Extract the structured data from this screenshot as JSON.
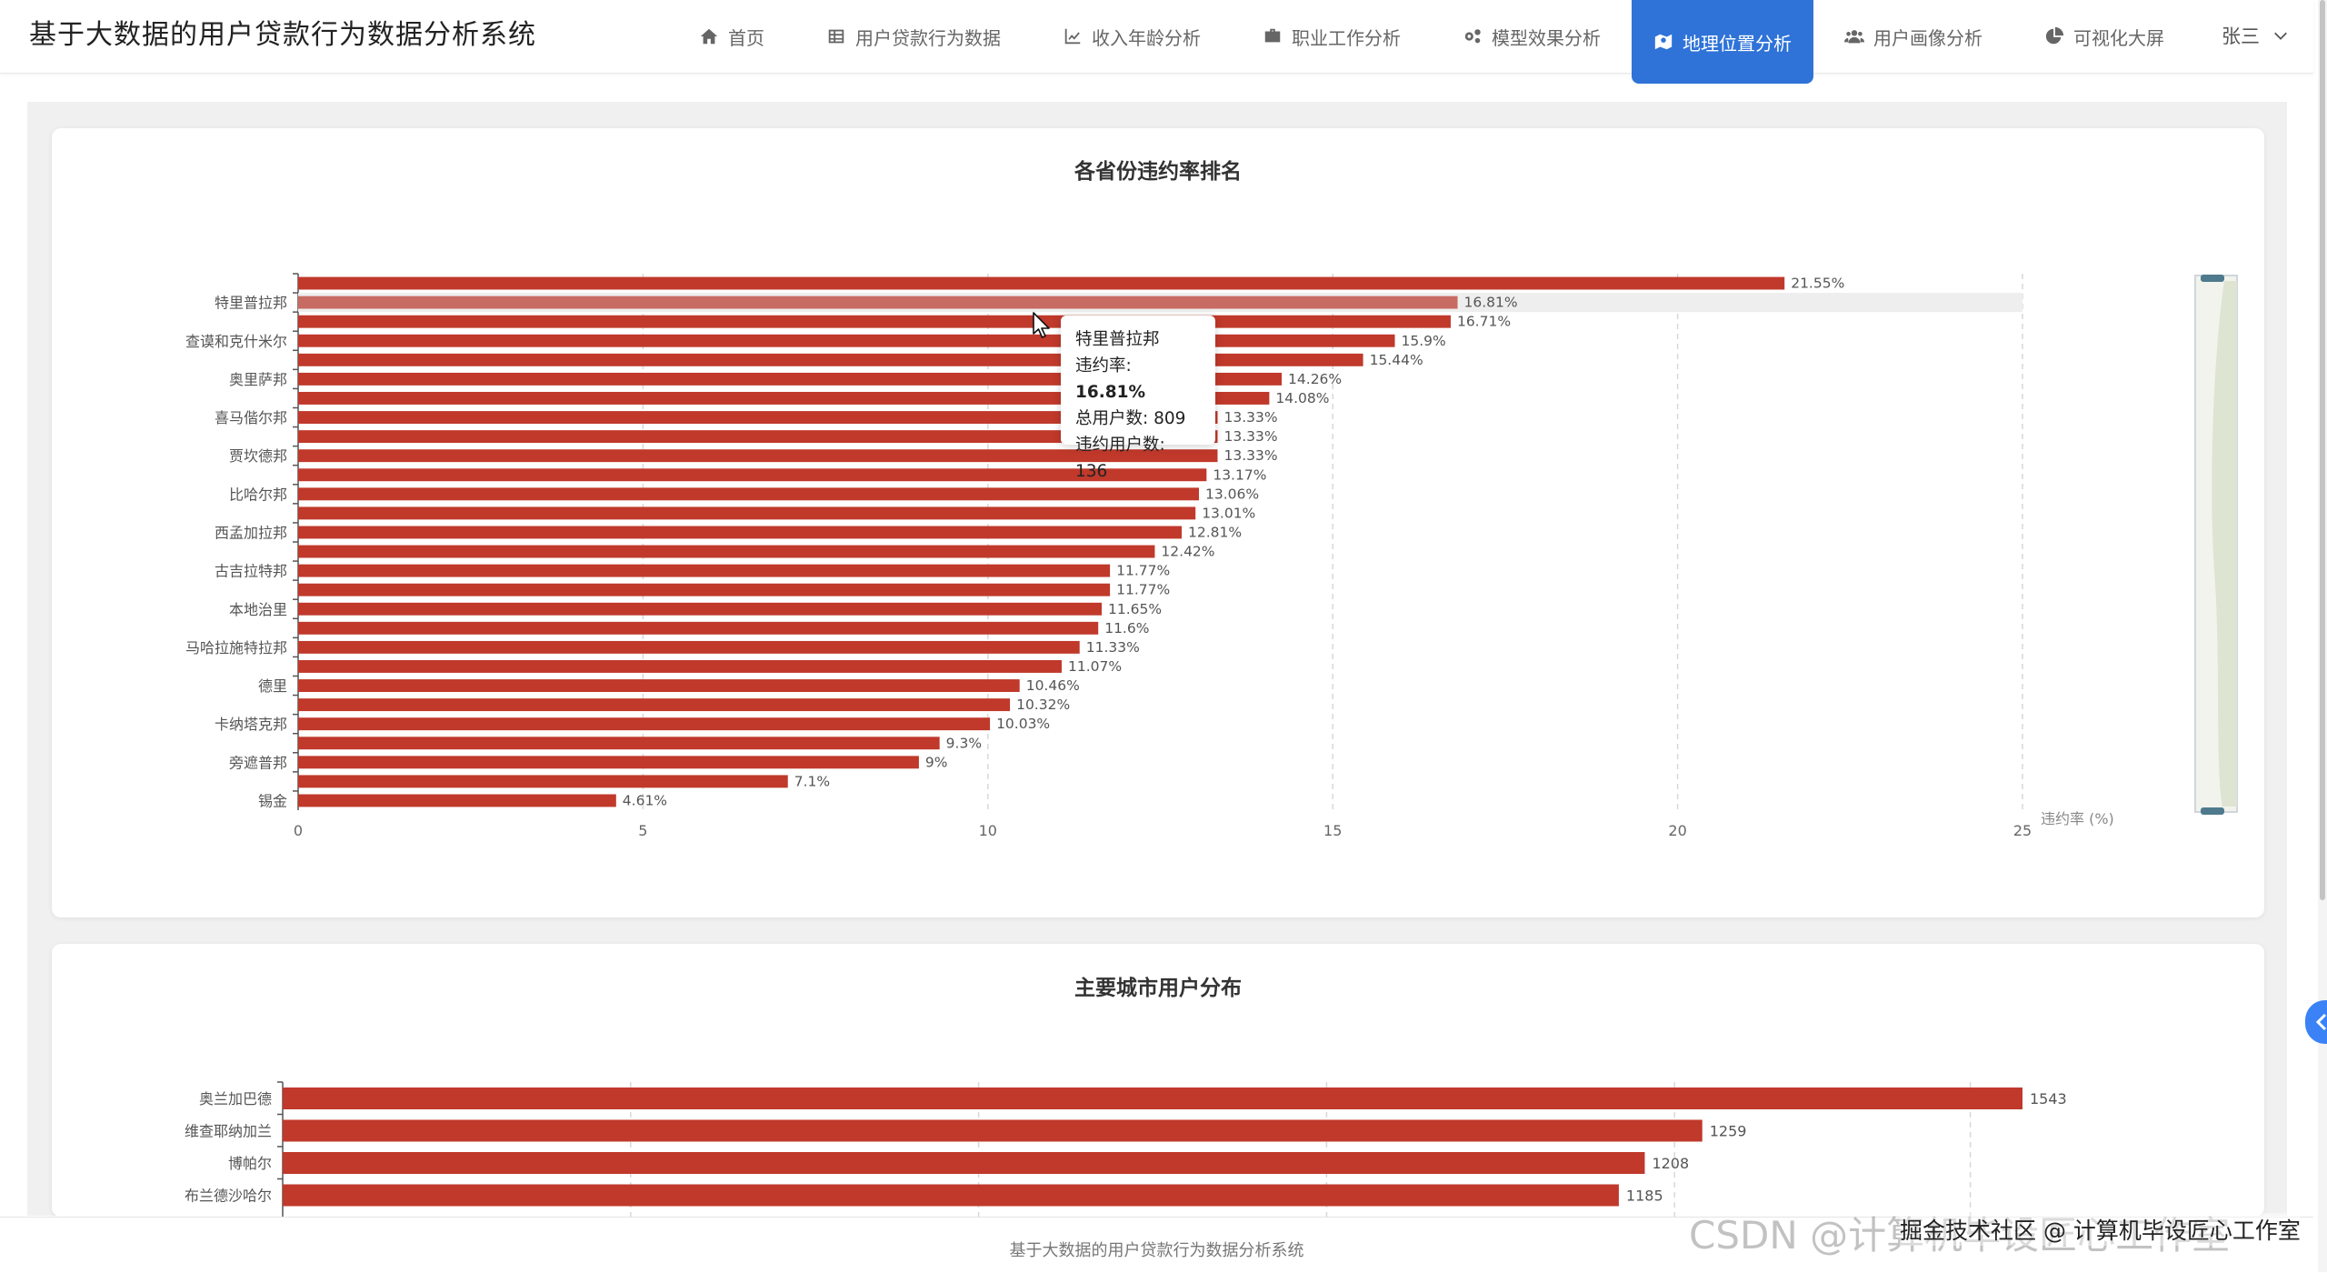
{
  "app": {
    "title": "基于大数据的用户贷款行为数据分析系统"
  },
  "nav": [
    {
      "label": "首页",
      "icon": "home-icon",
      "active": false
    },
    {
      "label": "用户贷款行为数据",
      "icon": "table-icon",
      "active": false
    },
    {
      "label": "收入年龄分析",
      "icon": "line-chart-icon",
      "active": false
    },
    {
      "label": "职业工作分析",
      "icon": "briefcase-icon",
      "active": false
    },
    {
      "label": "模型效果分析",
      "icon": "gears-icon",
      "active": false
    },
    {
      "label": "地理位置分析",
      "icon": "map-icon",
      "active": true
    },
    {
      "label": "用户画像分析",
      "icon": "users-icon",
      "active": false
    },
    {
      "label": "可视化大屏",
      "icon": "pie-chart-icon",
      "active": false
    }
  ],
  "user": {
    "name": "张三"
  },
  "colors": {
    "bar": "#c0392b",
    "accent": "#2f73d8",
    "highlight_bar": "#c86b62"
  },
  "chart_data": [
    {
      "type": "bar",
      "orientation": "horizontal",
      "title": "各省份违约率排名",
      "xlabel": "违约率 (%)",
      "xlim": [
        0,
        25
      ],
      "xticks": [
        0,
        5,
        10,
        15,
        20,
        25
      ],
      "grid": true,
      "categories": [
        "",
        "特里普拉邦",
        "",
        "查谟和克什米尔",
        "",
        "奥里萨邦",
        "",
        "喜马偕尔邦",
        "",
        "贾坎德邦",
        "",
        "比哈尔邦",
        "",
        "西孟加拉邦",
        "",
        "古吉拉特邦",
        "",
        "本地治里",
        "",
        "马哈拉施特拉邦",
        "",
        "德里",
        "",
        "卡纳塔克邦",
        "",
        "旁遮普邦",
        "",
        "锡金"
      ],
      "values": [
        21.55,
        16.81,
        16.71,
        15.9,
        15.44,
        14.26,
        14.08,
        13.33,
        13.33,
        13.33,
        13.17,
        13.06,
        13.01,
        12.81,
        12.42,
        11.77,
        11.77,
        11.65,
        11.6,
        11.33,
        11.07,
        10.46,
        10.32,
        10.03,
        9.3,
        9,
        7.1,
        4.61
      ],
      "value_labels": [
        "21.55%",
        "16.81%",
        "16.71%",
        "15.9%",
        "15.44%",
        "14.26%",
        "14.08%",
        "13.33%",
        "13.33%",
        "13.33%",
        "13.17%",
        "13.06%",
        "13.01%",
        "12.81%",
        "12.42%",
        "11.77%",
        "11.77%",
        "11.65%",
        "11.6%",
        "11.33%",
        "11.07%",
        "10.46%",
        "10.32%",
        "10.03%",
        "9.3%",
        "9%",
        "7.1%",
        "4.61%"
      ],
      "highlight_index": 1,
      "tooltip": {
        "name": "特里普拉邦",
        "rate_label": "违约率: ",
        "rate_value": "16.81%",
        "total_label": "总用户数: ",
        "total_value": "809",
        "default_label": "违约用户数: ",
        "default_value": "136"
      },
      "datazoom": "vertical-slider-right"
    },
    {
      "type": "bar",
      "orientation": "horizontal",
      "title": "主要城市用户分布",
      "xlim": [
        0,
        1543
      ],
      "grid": true,
      "categories": [
        "奥兰加巴德",
        "维查耶纳加兰",
        "博帕尔",
        "布兰德沙哈尔"
      ],
      "values": [
        1543,
        1259,
        1208,
        1185
      ],
      "value_labels": [
        "1543",
        "1259",
        "1208",
        "1185"
      ]
    }
  ],
  "footer": {
    "text": "基于大数据的用户贷款行为数据分析系统"
  },
  "watermark": {
    "outer": "CSDN @计算机毕设匠心工作室",
    "inner": "掘金技术社区 @ 计算机毕设匠心工作室"
  }
}
